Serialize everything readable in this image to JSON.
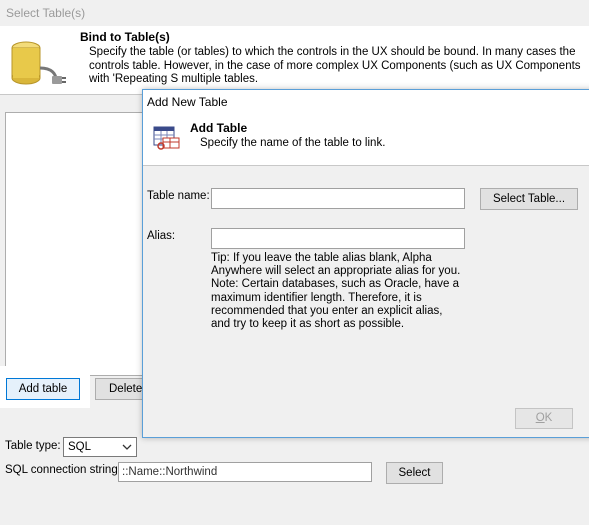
{
  "outer_window": {
    "title": "Select Table(s)",
    "header_title": "Bind to Table(s)",
    "header_desc": "Specify the table (or tables) to which the controls in the UX should be bound. In many cases the controls table. However, in the case of more complex UX Components (such as UX Components with 'Repeating S multiple tables.",
    "add_table_label": "Add table",
    "delete_label": "Delete",
    "table_type_label": "Table type:",
    "table_type_value": "SQL",
    "conn_label": "SQL connection string:",
    "conn_value": "::Name::Northwind",
    "select_label": "Select"
  },
  "modal": {
    "title": "Add New Table",
    "header_title": "Add Table",
    "header_desc": "Specify the name of the table to link.",
    "table_name_label": "Table name:",
    "table_name_value": "",
    "select_table_label": "Select Table...",
    "alias_label": "Alias:",
    "alias_value": "",
    "tip": "Tip: If you leave the table alias blank, Alpha Anywhere will select an appropriate alias for you. Note: Certain databases, such as Oracle, have a maximum identifier length. Therefore, it is recommended that you enter an explicit alias, and try to keep it as short as possible.",
    "ok_prefix": "",
    "ok_underlined": "O",
    "ok_rest": "K"
  },
  "icons": {
    "outer_header_icon": "database-plug-icon",
    "modal_header_icon": "table-link-icon",
    "select_chevron": "chevron-down-icon"
  },
  "colors": {
    "focus_border": "#0078d7",
    "modal_border": "#5a9fd8",
    "database_gold": "#e8c94a"
  }
}
